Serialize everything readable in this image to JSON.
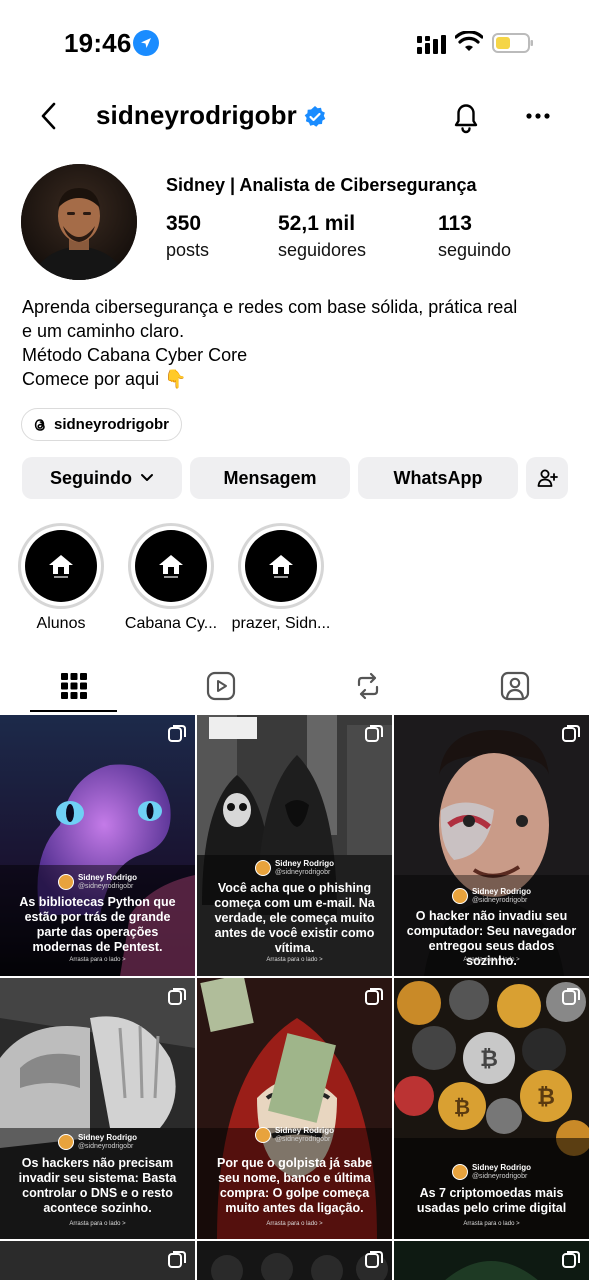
{
  "status_bar": {
    "time": "19:46"
  },
  "header": {
    "username": "sidneyrodrigobr"
  },
  "profile": {
    "display_name": "Sidney | Analista de Cibersegurança",
    "stats": [
      {
        "value": "350",
        "label": "posts"
      },
      {
        "value": "52,1 mil",
        "label": "seguidores"
      },
      {
        "value": "113",
        "label": "seguindo"
      }
    ],
    "bio_lines": [
      "Aprenda cibersegurança e redes com base sólida, prática real",
      "e um caminho claro.",
      "Método Cabana Cyber Core",
      "Comece por aqui 👇"
    ],
    "threads_handle": "sidneyrodrigobr"
  },
  "actions": {
    "following_label": "Seguindo",
    "message_label": "Mensagem",
    "whatsapp_label": "WhatsApp"
  },
  "highlights": [
    {
      "label": "Alunos"
    },
    {
      "label": "Cabana Cy..."
    },
    {
      "label": "prazer, Sidn..."
    }
  ],
  "tabs": [
    {
      "name": "posts-grid",
      "icon": "grid-icon"
    },
    {
      "name": "reels",
      "icon": "reels-icon"
    },
    {
      "name": "reposts",
      "icon": "repost-icon"
    },
    {
      "name": "tagged",
      "icon": "tagged-icon"
    }
  ],
  "posts": [
    {
      "author": "Sidney Rodrigo",
      "handle": "@sidneyrodrigobr",
      "caption": "As bibliotecas Python que estão por trás de grande parte das operações modernas de Pentest.",
      "swipe": "Arrasta para o lado >",
      "bg": "#3a2a6a"
    },
    {
      "author": "Sidney Rodrigo",
      "handle": "@sidneyrodrigobr",
      "caption": "Você acha que o phishing começa com um e-mail. Na verdade, ele começa muito antes de você existir como vítima.",
      "swipe": "Arrasta para o lado >",
      "bg": "#2c2c2c"
    },
    {
      "author": "Sidney Rodrigo",
      "handle": "@sidneyrodrigobr",
      "caption": "O hacker não invadiu seu computador: Seu navegador entregou seus dados sozinho.",
      "swipe": "Arrasta para o lado >",
      "bg": "#3b2a24"
    },
    {
      "author": "Sidney Rodrigo",
      "handle": "@sidneyrodrigobr",
      "caption": "Os hackers não precisam invadir seu sistema: Basta controlar o DNS e o resto acontece sozinho.",
      "swipe": "Arrasta para o lado >",
      "bg": "#2a2a2a"
    },
    {
      "author": "Sidney Rodrigo",
      "handle": "@sidneyrodrigobr",
      "caption": "Por que o golpista já sabe seu nome, banco e última compra: O golpe começa muito antes da ligação.",
      "swipe": "Arrasta para o lado >",
      "bg": "#5a1a14"
    },
    {
      "author": "Sidney Rodrigo",
      "handle": "@sidneyrodrigobr",
      "caption": "As 7 criptomoedas mais usadas pelo crime digital",
      "swipe": "Arrasta para o lado >",
      "bg": "#3a2f1a"
    }
  ],
  "colors": {
    "verified": "#1a8cff",
    "button_bg": "#efeff1",
    "battery": "#f5d547"
  }
}
